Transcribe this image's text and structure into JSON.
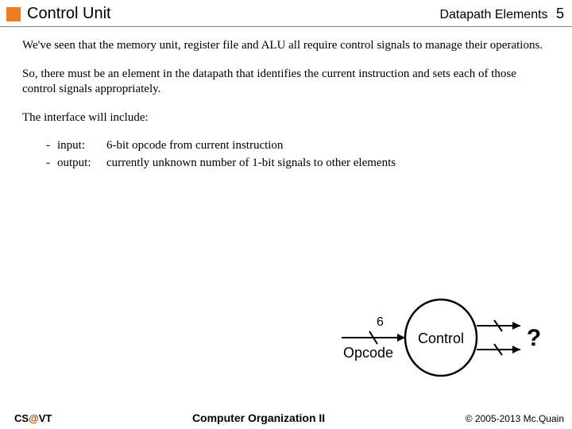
{
  "header": {
    "title_left": "Control Unit",
    "title_right": "Datapath Elements",
    "page_num": "5"
  },
  "body": {
    "p1": "We've seen that the memory unit, register file and ALU all require control signals to manage their operations.",
    "p2": "So, there must be an element in the datapath that identifies the current instruction and sets each of those control signals appropriately.",
    "p3": "The interface will include:",
    "io": {
      "input_label": "input:",
      "input_desc": "6-bit opcode from current instruction",
      "output_label": "output:",
      "output_desc": "currently unknown number of 1-bit signals to other elements"
    }
  },
  "diagram": {
    "opcode_label": "Opcode",
    "opcode_bits": "6",
    "control_label": "Control",
    "question": "?"
  },
  "footer": {
    "left_cs": "CS",
    "left_at": "@",
    "left_vt": "VT",
    "center": "Computer Organization II",
    "right": "© 2005-2013 Mc.Quain"
  }
}
